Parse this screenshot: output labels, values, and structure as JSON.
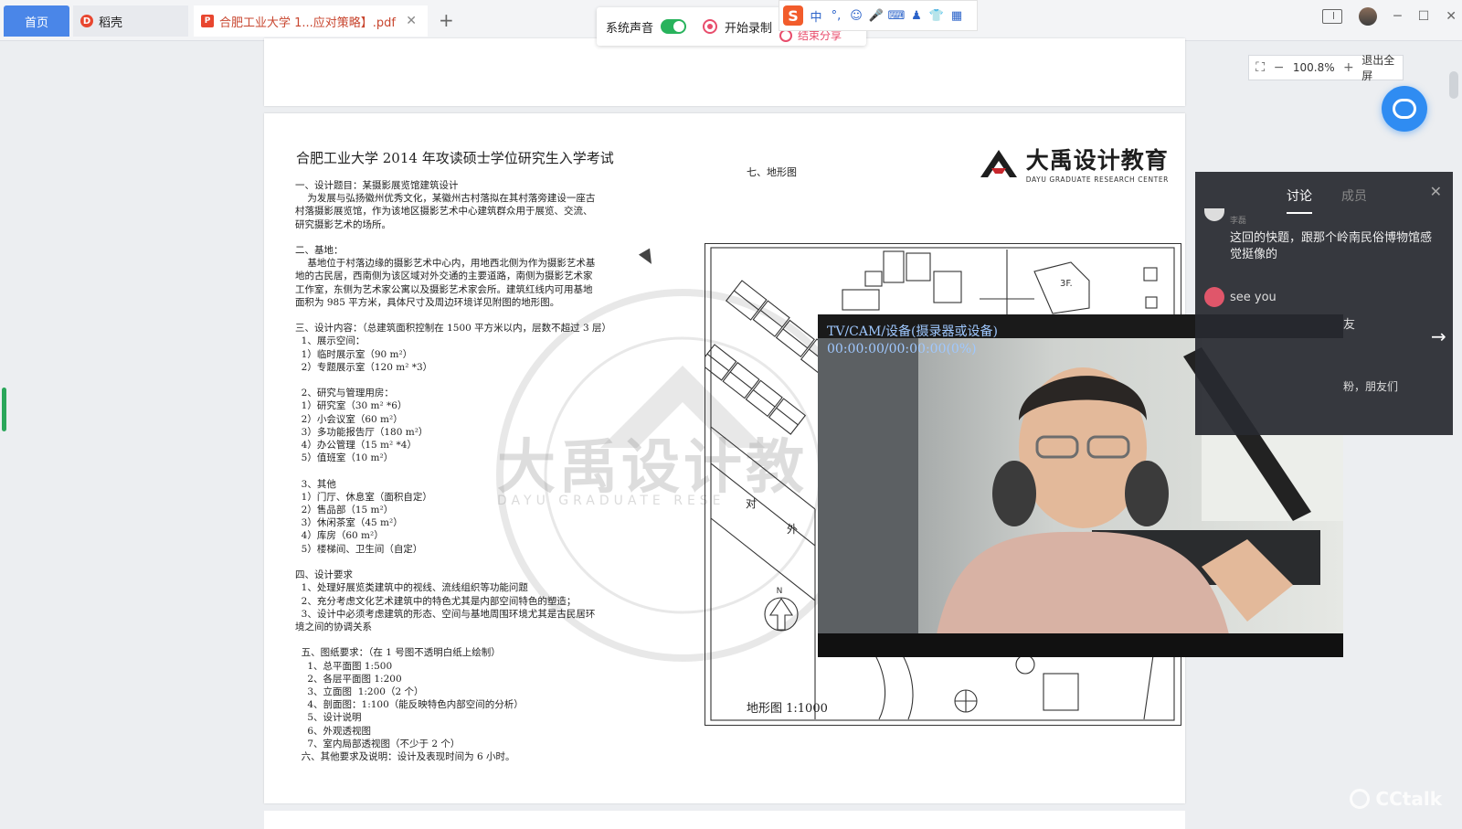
{
  "tabs": {
    "home": "首页",
    "shell": "稻壳",
    "pdf": "合肥工业大学  1...应对策略】.pdf",
    "close": "✕",
    "add": "+"
  },
  "recording": {
    "system_sound": "系统声音",
    "start_recording": "开始录制",
    "end_share": "结束分享"
  },
  "ime": {
    "logo": "S",
    "mode": "中",
    "punct": "°,",
    "emoji": "☺",
    "mic": "🎤",
    "keyboard": "⌨",
    "person": "♟",
    "skin": "👕",
    "grid": "▦"
  },
  "document": {
    "title": "合肥工业大学 2014 年攻读硕士学位研究生入学考试",
    "lines": [
      "一、设计题目：某摄影展览馆建筑设计",
      "    为发展与弘扬徽州优秀文化，某徽州古村落拟在其村落旁建设一座古",
      "村落摄影展览馆，作为该地区摄影艺术中心建筑群众用于展览、交流、",
      "研究摄影艺术的场所。",
      "",
      "二、基地：",
      "    基地位于村落边缘的摄影艺术中心内，用地西北侧为作为摄影艺术基",
      "地的古民居，西南侧为该区域对外交通的主要道路，南侧为摄影艺术家",
      "工作室，东侧为艺术家公寓以及摄影艺术家会所。建筑红线内可用基地",
      "面积为 985 平方米，具体尺寸及周边环境详见附图的地形图。",
      "",
      "三、设计内容：（总建筑面积控制在 1500 平方米以内，层数不超过 3 层）",
      "  1、展示空间：",
      "  1）临时展示室（90 m²）",
      "  2）专题展示室（120 m² *3）",
      "",
      "  2、研究与管理用房：",
      "  1）研究室（30 m² *6）",
      "  2）小会议室（60 m²）",
      "  3）多功能报告厅（180 m²）",
      "  4）办公管理（15 m² *4）",
      "  5）值班室（10 m²）",
      "",
      "  3、其他",
      "  1）门厅、休息室（面积自定）",
      "  2）售品部（15 m²）",
      "  3）休闲茶室（45 m²）",
      "  4）库房（60 m²）",
      "  5）楼梯间、卫生间（自定）",
      "",
      "四、设计要求",
      "  1、处理好展览类建筑中的视线、流线组织等功能问题",
      "  2、充分考虑文化艺术建筑中的特色尤其是内部空间特色的塑造；",
      "  3、设计中必须考虑建筑的形态、空间与基地周围环境尤其是古民居环",
      "境之间的协调关系",
      "",
      "  五、图纸要求：（在 1 号图不透明白纸上绘制）",
      "    1、总平面图 1:500",
      "    2、各层平面图 1:200",
      "    3、立面图  1:200（2 个）",
      "    4、剖面图：1:100（能反映特色内部空间的分析）",
      "    5、设计说明",
      "    6、外观透视图",
      "    7、室内局部透视图（不少于 2 个）",
      "  六、其他要求及说明：设计及表现时间为 6 小时。"
    ],
    "brand_name": "大禹设计教育",
    "brand_sub": "DAYU GRADUATE RESEARCH CENTER",
    "map_heading": "七、地形图",
    "map_caption": "地形图  1:1000",
    "map_label_1": "对",
    "map_label_2": "外",
    "map_label_3f": "3F.",
    "map_north": "N",
    "watermark": "大禹设计教",
    "watermark_sub": "DAYU GRADUATE RESE"
  },
  "webcam": {
    "label": "TV/CAM/设备(摄录器或设备)",
    "time": "00:00:00/00:00:00(0%)"
  },
  "zoom": {
    "minus": "−",
    "value": "100.8%",
    "plus": "+",
    "exit": "退出全屏"
  },
  "panel": {
    "tab_discussion": "讨论",
    "tab_members": "成员",
    "close": "✕",
    "msg1_name": "李磊",
    "msg1": "这回的快题，跟那个岭南民俗博物馆感觉挺像的",
    "msg2": "see you",
    "frag1": "友",
    "frag2": "粉，朋友们",
    "arrow": "→"
  },
  "watermark_brand": "CCtalk"
}
